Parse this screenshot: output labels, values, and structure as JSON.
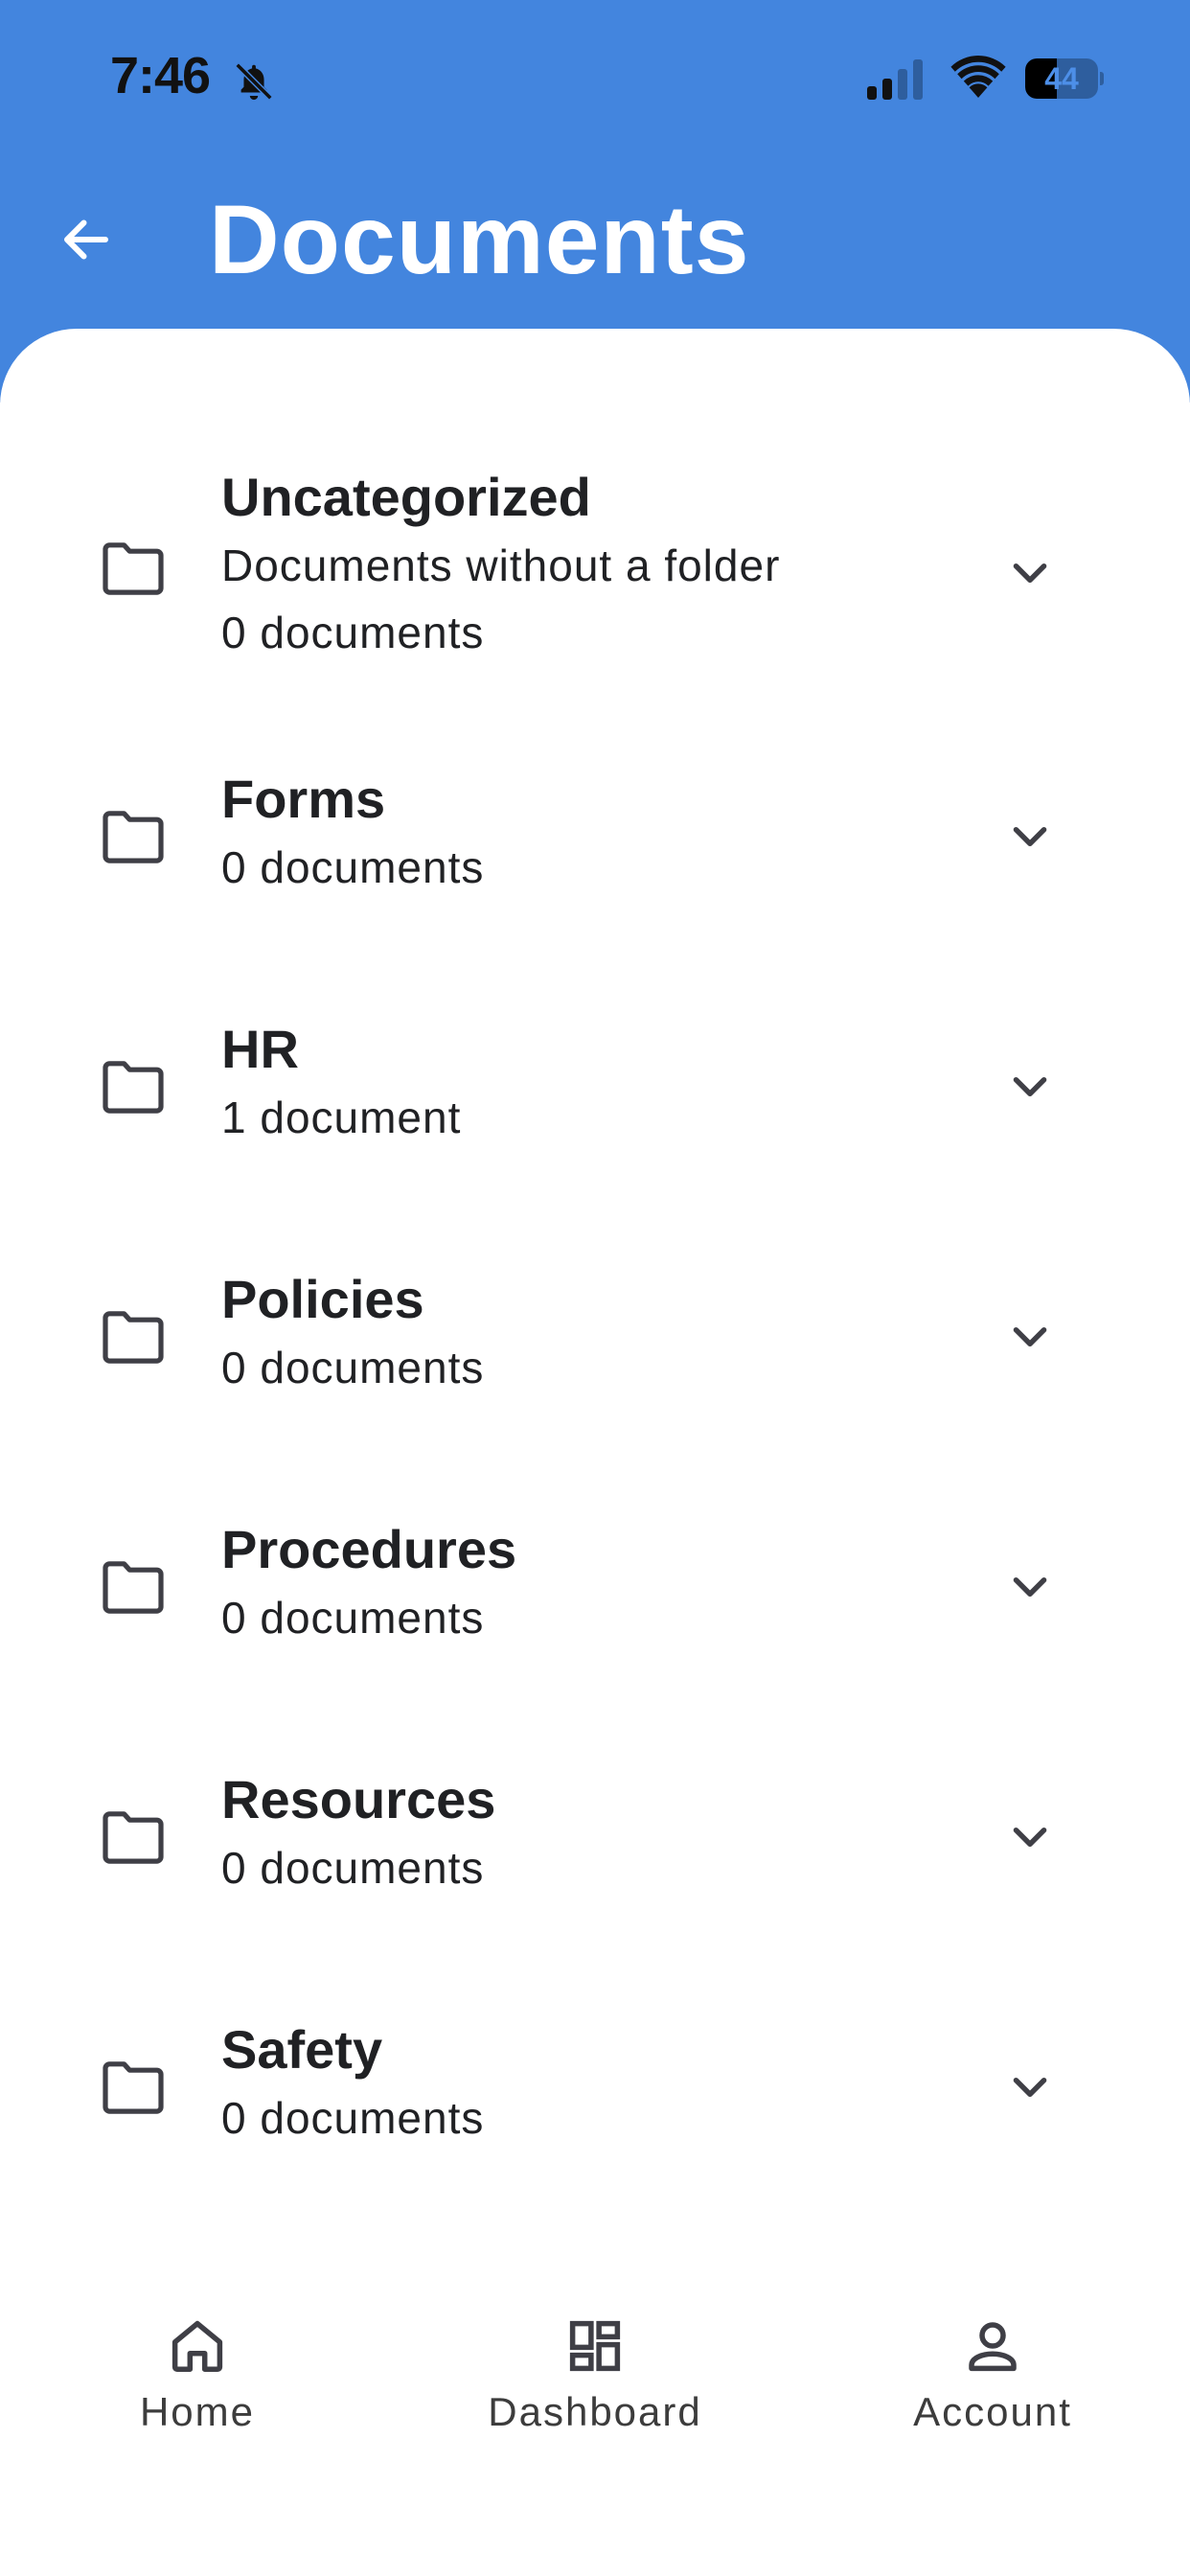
{
  "status_bar": {
    "time": "7:46",
    "battery_level": "44",
    "battery_fraction": 0.44,
    "icons": [
      "bell-off-icon",
      "signal-icon",
      "wifi-icon",
      "battery-icon"
    ]
  },
  "header": {
    "title": "Documents",
    "back_icon": "arrow-left-icon",
    "background_color": "#4385DE"
  },
  "folders": [
    {
      "name": "Uncategorized",
      "description": "Documents without a folder",
      "count": "0 documents"
    },
    {
      "name": "Forms",
      "count": "0 documents"
    },
    {
      "name": "HR",
      "count": "1 document"
    },
    {
      "name": "Policies",
      "count": "0 documents"
    },
    {
      "name": "Procedures",
      "count": "0 documents"
    },
    {
      "name": "Resources",
      "count": "0 documents"
    },
    {
      "name": "Safety",
      "count": "0 documents"
    }
  ],
  "bottom_nav": {
    "items": [
      {
        "label": "Home",
        "icon": "home-icon"
      },
      {
        "label": "Dashboard",
        "icon": "dashboard-icon"
      },
      {
        "label": "Account",
        "icon": "account-icon"
      }
    ]
  }
}
